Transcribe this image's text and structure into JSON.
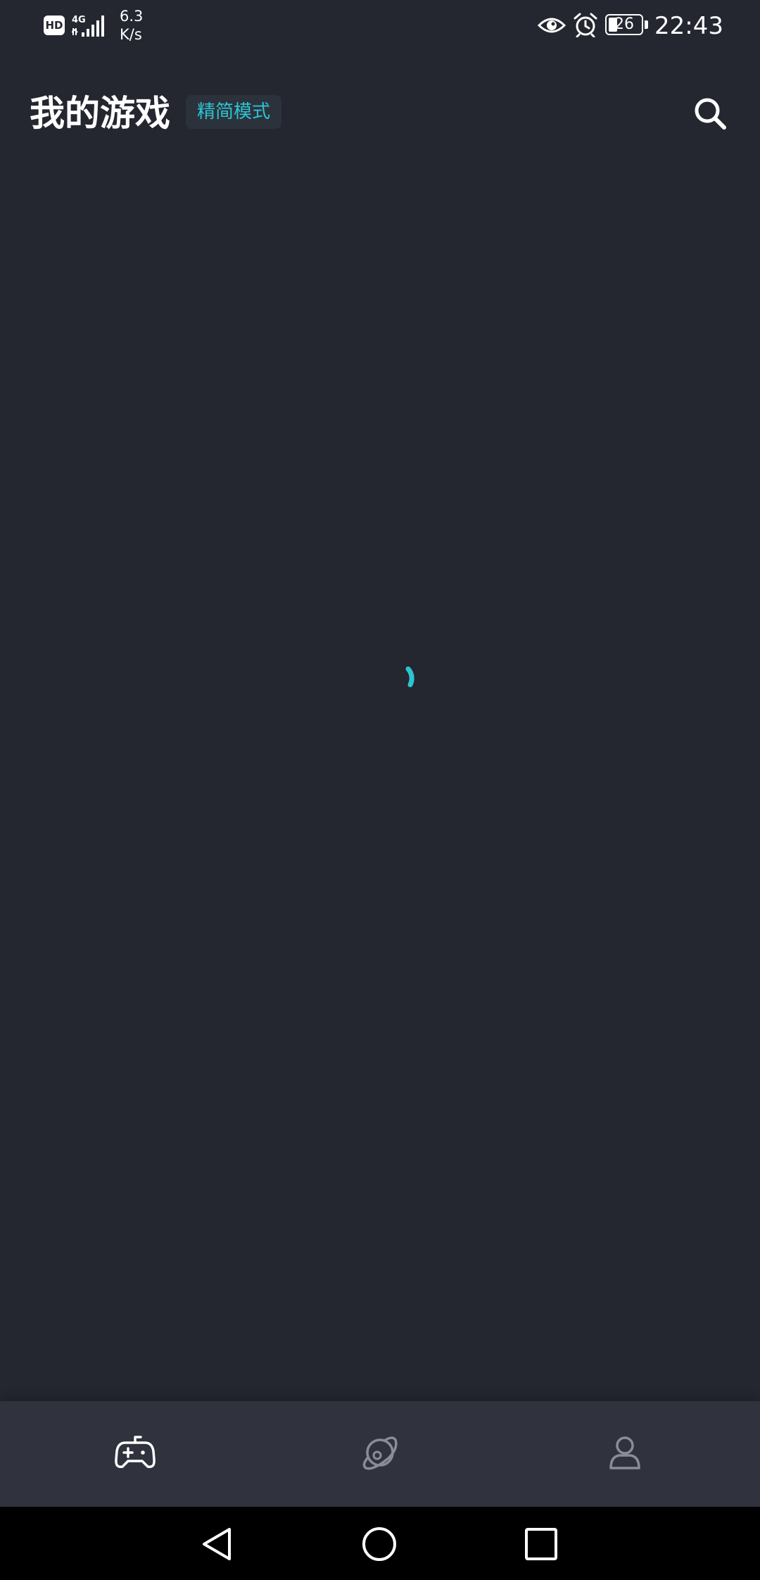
{
  "status_bar": {
    "hd_badge": "HD",
    "network_type": "4G",
    "speed_value": "6.3",
    "speed_unit": "K/s",
    "battery_level": "26",
    "time": "22:43",
    "icons": [
      "hd-icon",
      "signal-icon",
      "eye-icon",
      "alarm-icon",
      "battery-icon"
    ]
  },
  "header": {
    "title": "我的游戏",
    "mode_chip": "精简模式",
    "search_icon": "search-icon"
  },
  "content": {
    "loading": true,
    "spinner_icon": "loading-spinner-icon"
  },
  "tab_bar": {
    "tabs": [
      {
        "icon": "gamepad-icon",
        "active": true
      },
      {
        "icon": "planet-icon",
        "active": false
      },
      {
        "icon": "person-icon",
        "active": false
      }
    ]
  },
  "nav_bar": {
    "buttons": [
      "back-icon",
      "home-icon",
      "recent-apps-icon"
    ]
  },
  "colors": {
    "background": "#242630",
    "accent": "#2ec3d3",
    "tab_bar": "#30333d",
    "inactive_icon": "#8a8d96",
    "text": "#ffffff"
  }
}
